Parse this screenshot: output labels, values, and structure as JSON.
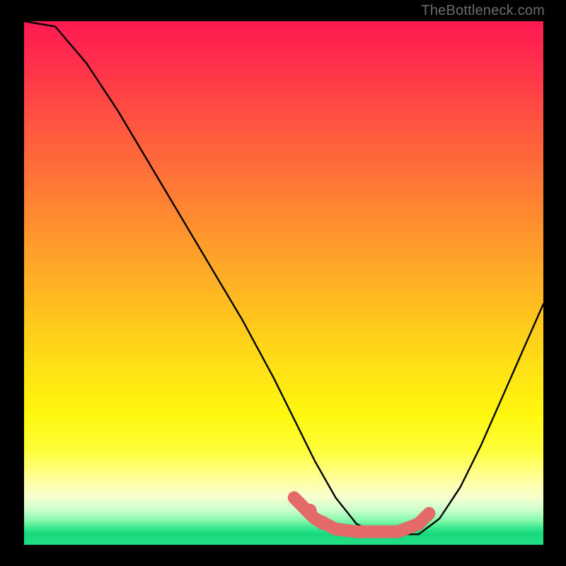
{
  "watermark": "TheBottleneck.com",
  "chart_data": {
    "type": "line",
    "title": "",
    "xlabel": "",
    "ylabel": "",
    "xlim": [
      0,
      100
    ],
    "ylim": [
      0,
      100
    ],
    "series": [
      {
        "name": "bottleneck-curve",
        "x": [
          0,
          6,
          12,
          18,
          24,
          30,
          36,
          42,
          48,
          52,
          56,
          60,
          64,
          68,
          72,
          76,
          80,
          84,
          88,
          92,
          96,
          100
        ],
        "values": [
          100,
          99,
          92,
          83,
          73,
          63,
          53,
          43,
          32,
          24,
          16,
          9,
          4,
          2,
          2,
          2,
          5,
          11,
          19,
          28,
          37,
          46
        ]
      }
    ],
    "highlight_segment": {
      "name": "optimal-range",
      "x": [
        52,
        56,
        60,
        64,
        68,
        72,
        76,
        78
      ],
      "values": [
        9,
        5,
        3,
        2.5,
        2.5,
        2.5,
        4,
        6
      ]
    },
    "highlight_dots": [
      {
        "x": 55,
        "y": 6.5
      },
      {
        "x": 57.5,
        "y": 4.2
      }
    ]
  }
}
